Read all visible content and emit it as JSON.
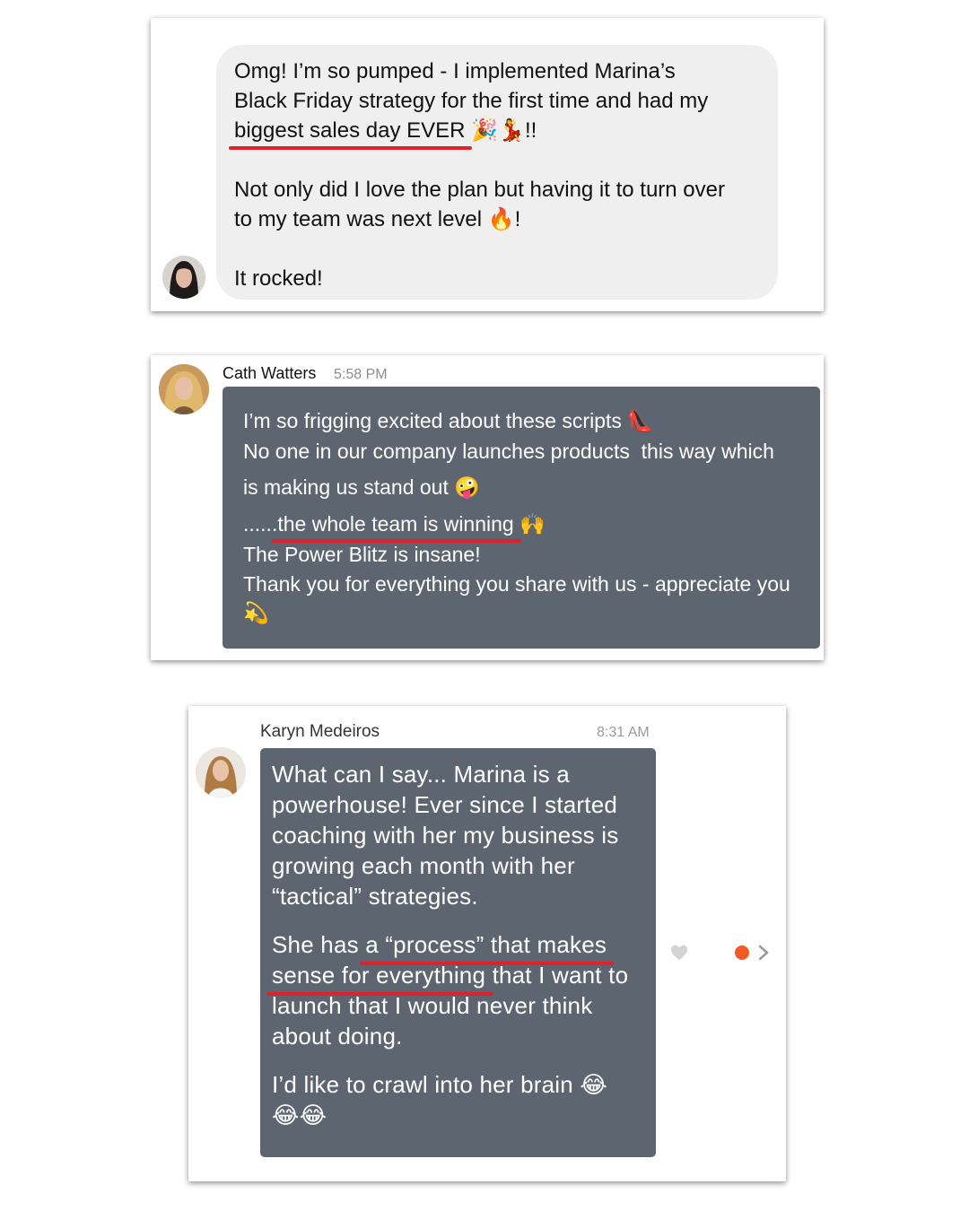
{
  "testimonial_1": {
    "lines": [
      "Omg! I’m so pumped - I implemented Marina’s",
      "Black Friday strategy for the first time and had my"
    ],
    "highlight": "biggest sales day EVER",
    "highlight_suffix": "!!",
    "paragraph_2": [
      "Not only did I love the plan but having it to turn over",
      "to my team was next level"
    ],
    "paragraph_2_suffix": "!",
    "paragraph_3": "It rocked!",
    "emojis": {
      "party": "🎉",
      "dancer": "💃",
      "fire": "🔥"
    }
  },
  "testimonial_2": {
    "name": "Cath Watters",
    "time": "5:58 PM",
    "line_1": "I’m so frigging excited about these scripts",
    "line_2": "No one in our company launches products  this way which",
    "line_3": "is making us stand out",
    "line_4_prefix": "......",
    "line_4_highlight": "the whole team is winning",
    "line_5": "The Power Blitz is insane!",
    "line_6": "Thank you for everything you share with us - appreciate you",
    "emojis": {
      "heel": "👠",
      "zany": "🤪",
      "praise": "🙌",
      "dizzy": "💫"
    }
  },
  "testimonial_3": {
    "name": "Karyn Medeiros",
    "time": "8:31 AM",
    "paragraph_1": [
      "What can I say... Marina is a",
      "powerhouse! Ever since I started",
      "coaching with her my business is",
      "growing each month with her",
      "“tactical” strategies."
    ],
    "p2_line1_prefix": "She has ",
    "p2_line1_highlight": "a “process” that makes",
    "p2_line2_highlight": "sense for everything",
    "p2_line2_suffix": " that I want to",
    "p2_line3": "launch that I would never think",
    "p2_line4": "about doing.",
    "paragraph_3": "I’d like to crawl into her brain",
    "emojis": {
      "laugh_1": "😂",
      "laugh_2": "😂😂"
    }
  },
  "colors": {
    "dark_bubble": "#5d6670",
    "light_bubble": "#efefef",
    "underline_red": "#e0202a",
    "status_dot": "#f15a22"
  }
}
